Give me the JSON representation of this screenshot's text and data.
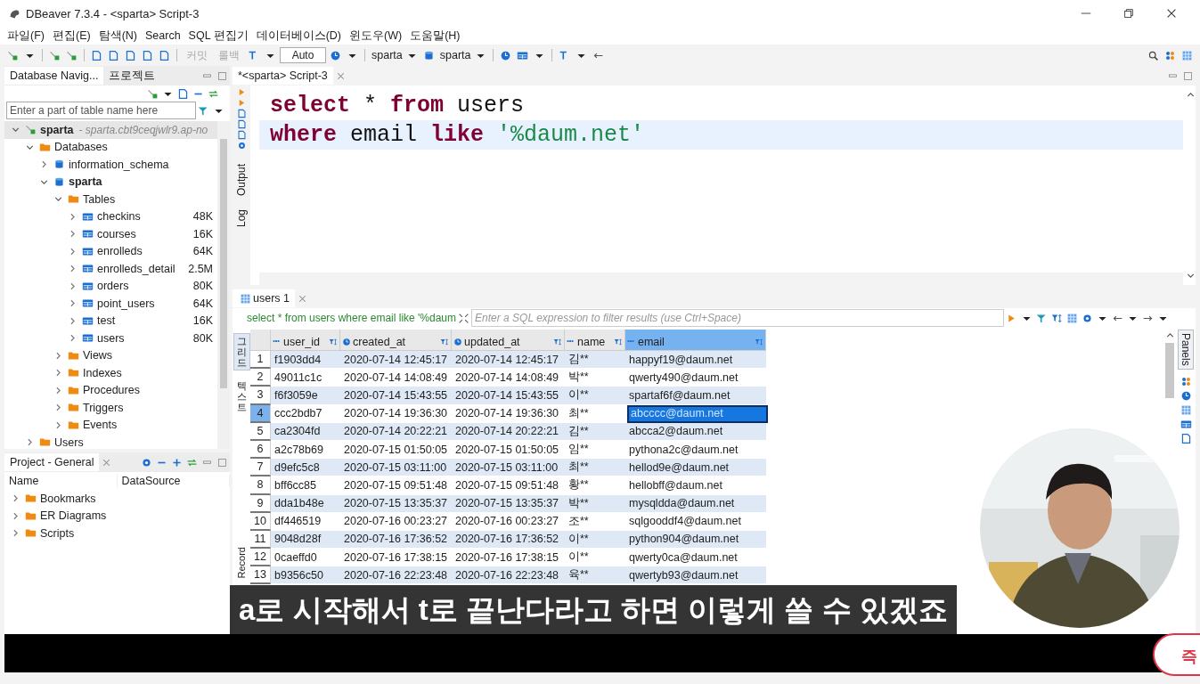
{
  "window": {
    "title": "DBeaver 7.3.4 - <sparta> Script-3"
  },
  "menu": [
    "파일(F)",
    "편집(E)",
    "탐색(N)",
    "Search",
    "SQL 편집기",
    "데이터베이스(D)",
    "윈도우(W)",
    "도움말(H)"
  ],
  "toolbar": {
    "commit": {
      "label": "커밋",
      "disabled": true
    },
    "rollback": {
      "label": "롤백",
      "disabled": true
    },
    "mode": "Auto",
    "connection": "sparta",
    "database": "sparta"
  },
  "navigator": {
    "tabs": [
      {
        "label": "Database Navig...",
        "selected": true
      },
      {
        "label": "프로젝트",
        "selected": false
      }
    ],
    "filter": {
      "placeholder": "Enter a part of table name here"
    },
    "tree": [
      {
        "label": "sparta",
        "kind": "connection",
        "note": "- sparta.cbt9ceqjwlr9.ap-no",
        "expanded": true,
        "children": [
          {
            "label": "Databases",
            "kind": "folder",
            "expanded": true,
            "children": [
              {
                "label": "information_schema",
                "kind": "database",
                "default": false,
                "expanded": false
              },
              {
                "label": "sparta",
                "kind": "database",
                "default": true,
                "expanded": true,
                "children": [
                  {
                    "label": "Tables",
                    "kind": "folder",
                    "expanded": true,
                    "children": [
                      {
                        "label": "checkins",
                        "kind": "table",
                        "size": "48K",
                        "expanded": false
                      },
                      {
                        "label": "courses",
                        "kind": "table",
                        "size": "16K",
                        "expanded": false
                      },
                      {
                        "label": "enrolleds",
                        "kind": "table",
                        "size": "64K",
                        "expanded": false
                      },
                      {
                        "label": "enrolleds_detail",
                        "kind": "table",
                        "size": "2.5M",
                        "expanded": false
                      },
                      {
                        "label": "orders",
                        "kind": "table",
                        "size": "80K",
                        "expanded": false
                      },
                      {
                        "label": "point_users",
                        "kind": "table",
                        "size": "64K",
                        "expanded": false
                      },
                      {
                        "label": "test",
                        "kind": "table",
                        "size": "16K",
                        "expanded": false
                      },
                      {
                        "label": "users",
                        "kind": "table",
                        "size": "80K",
                        "expanded": false
                      }
                    ]
                  },
                  {
                    "label": "Views",
                    "kind": "folder",
                    "expanded": false
                  },
                  {
                    "label": "Indexes",
                    "kind": "folder",
                    "expanded": false
                  },
                  {
                    "label": "Procedures",
                    "kind": "folder",
                    "expanded": false
                  },
                  {
                    "label": "Triggers",
                    "kind": "folder",
                    "expanded": false
                  },
                  {
                    "label": "Events",
                    "kind": "folder",
                    "expanded": false
                  }
                ]
              }
            ]
          },
          {
            "label": "Users",
            "kind": "folder",
            "expanded": false
          }
        ]
      }
    ]
  },
  "project": {
    "tab": "Project - General",
    "columns": [
      "Name",
      "DataSource"
    ],
    "items": [
      {
        "label": "Bookmarks",
        "expanded": false
      },
      {
        "label": "ER Diagrams",
        "expanded": false
      },
      {
        "label": "Scripts",
        "expanded": false
      }
    ]
  },
  "editor": {
    "tab": {
      "label": "*<sparta> Script-3",
      "selected": true
    },
    "side_tabs": [
      "Output",
      "Log"
    ],
    "lines": [
      {
        "current": false,
        "tokens": [
          {
            "kind": "keyword",
            "text": "select"
          },
          {
            "kind": "plain",
            "text": " * "
          },
          {
            "kind": "keyword",
            "text": "from"
          },
          {
            "kind": "plain",
            "text": " users"
          }
        ]
      },
      {
        "current": true,
        "tokens": [
          {
            "kind": "keyword",
            "text": "where"
          },
          {
            "kind": "plain",
            "text": " email "
          },
          {
            "kind": "keyword",
            "text": "like "
          },
          {
            "kind": "string",
            "text": "'%daum.net'"
          }
        ]
      }
    ]
  },
  "results": {
    "tab": "users 1",
    "query": "select * from users where email like '%daum",
    "filter_placeholder": "Enter a SQL expression to filter results (use Ctrl+Space)",
    "side_tabs": [
      {
        "label": "그리드",
        "selected": true
      },
      {
        "label": "텍스트",
        "selected": false
      },
      {
        "label": "Record",
        "selected": false
      }
    ],
    "right_tab": "Panels",
    "columns": [
      {
        "name": "user_id",
        "kind": "text",
        "selected": false
      },
      {
        "name": "created_at",
        "kind": "time",
        "selected": false
      },
      {
        "name": "updated_at",
        "kind": "time",
        "selected": false
      },
      {
        "name": "name",
        "kind": "text",
        "selected": false
      },
      {
        "name": "email",
        "kind": "text",
        "selected": true
      }
    ],
    "rows": [
      {
        "num": "1",
        "selected": false,
        "cells": [
          "f1903dd4",
          "2020-07-14 12:45:17",
          "2020-07-14 12:45:17",
          "김**",
          "happyf19@daum.net"
        ]
      },
      {
        "num": "2",
        "selected": false,
        "cells": [
          "49011c1c",
          "2020-07-14 14:08:49",
          "2020-07-14 14:08:49",
          "박**",
          "qwerty490@daum.net"
        ]
      },
      {
        "num": "3",
        "selected": false,
        "cells": [
          "f6f3059e",
          "2020-07-14 15:43:55",
          "2020-07-14 15:43:55",
          "이**",
          "spartaf6f@daum.net"
        ]
      },
      {
        "num": "4",
        "selected": true,
        "cells": [
          "ccc2bdb7",
          "2020-07-14 19:36:30",
          "2020-07-14 19:36:30",
          "최**",
          "abcccc@daum.net"
        ]
      },
      {
        "num": "5",
        "selected": false,
        "cells": [
          "ca2304fd",
          "2020-07-14 20:22:21",
          "2020-07-14 20:22:21",
          "김**",
          "abcca2@daum.net"
        ]
      },
      {
        "num": "6",
        "selected": false,
        "cells": [
          "a2c78b69",
          "2020-07-15 01:50:05",
          "2020-07-15 01:50:05",
          "임**",
          "pythona2c@daum.net"
        ]
      },
      {
        "num": "7",
        "selected": false,
        "cells": [
          "d9efc5c8",
          "2020-07-15 03:11:00",
          "2020-07-15 03:11:00",
          "최**",
          "hellod9e@daum.net"
        ]
      },
      {
        "num": "8",
        "selected": false,
        "cells": [
          "bff6cc85",
          "2020-07-15 09:51:48",
          "2020-07-15 09:51:48",
          "황**",
          "hellobff@daum.net"
        ]
      },
      {
        "num": "9",
        "selected": false,
        "cells": [
          "dda1b48e",
          "2020-07-15 13:35:37",
          "2020-07-15 13:35:37",
          "박**",
          "mysqldda@daum.net"
        ]
      },
      {
        "num": "10",
        "selected": false,
        "cells": [
          "df446519",
          "2020-07-16 00:23:27",
          "2020-07-16 00:23:27",
          "조**",
          "sqlgooddf4@daum.net"
        ]
      },
      {
        "num": "11",
        "selected": false,
        "cells": [
          "9048d28f",
          "2020-07-16 17:36:52",
          "2020-07-16 17:36:52",
          "이**",
          "python904@daum.net"
        ]
      },
      {
        "num": "12",
        "selected": false,
        "cells": [
          "0caeffd0",
          "2020-07-16 17:38:15",
          "2020-07-16 17:38:15",
          "이**",
          "qwerty0ca@daum.net"
        ]
      },
      {
        "num": "13",
        "selected": false,
        "cells": [
          "b9356c50",
          "2020-07-16 22:23:48",
          "2020-07-16 22:23:48",
          "육**",
          "qwertyb93@daum.net"
        ]
      }
    ]
  },
  "video": {
    "subtitle": "a로 시작해서 t로 끝난다라고 하면 이렇게 쓸 수 있겠죠",
    "action_button": "즉"
  }
}
